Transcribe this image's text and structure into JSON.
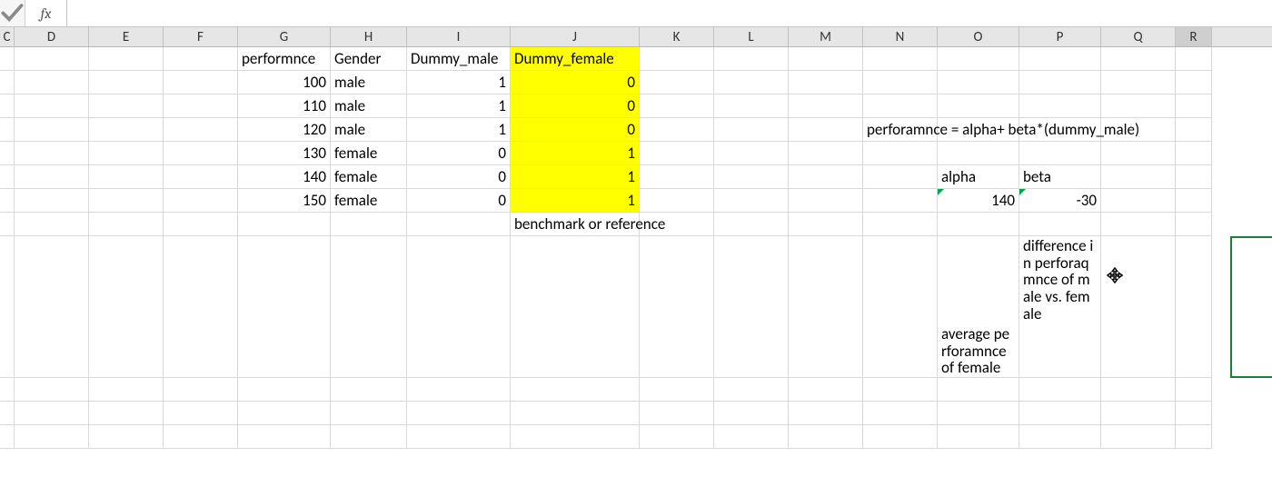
{
  "chart_data": {
    "type": "table",
    "title": "",
    "columns": [
      "performnce",
      "Gender",
      "Dummy_male",
      "Dummy_female"
    ],
    "rows": [
      [
        100,
        "male",
        1,
        0
      ],
      [
        110,
        "male",
        1,
        0
      ],
      [
        120,
        "male",
        1,
        0
      ],
      [
        130,
        "female",
        0,
        1
      ],
      [
        140,
        "female",
        0,
        1
      ],
      [
        150,
        "female",
        0,
        1
      ]
    ]
  },
  "columns": [
    "C",
    "D",
    "E",
    "F",
    "G",
    "H",
    "I",
    "J",
    "K",
    "L",
    "M",
    "N",
    "O",
    "P",
    "Q",
    "R"
  ],
  "formula_bar": {
    "fx_label": "fx",
    "value": ""
  },
  "headers": {
    "G": "performnce",
    "H": "Gender",
    "I": "Dummy_male",
    "J": "Dummy_female"
  },
  "rows": [
    {
      "G": "100",
      "H": "male",
      "I": "1",
      "J": "0"
    },
    {
      "G": "110",
      "H": "male",
      "I": "1",
      "J": "0"
    },
    {
      "G": "120",
      "H": "male",
      "I": "1",
      "J": "0"
    },
    {
      "G": "130",
      "H": "female",
      "I": "0",
      "J": "1"
    },
    {
      "G": "140",
      "H": "female",
      "I": "0",
      "J": "1"
    },
    {
      "G": "150",
      "H": "female",
      "I": "0",
      "J": "1"
    }
  ],
  "note_J8": "benchmark or reference",
  "formula_text_N4": "perforamnce  = alpha+ beta*(dummy_male)",
  "labels": {
    "alpha": "alpha",
    "beta": "beta"
  },
  "values": {
    "alpha": "140",
    "beta": "-30"
  },
  "desc_O": "average perforamnce of female",
  "desc_P": "difference in perforaqmnce of male vs. female"
}
